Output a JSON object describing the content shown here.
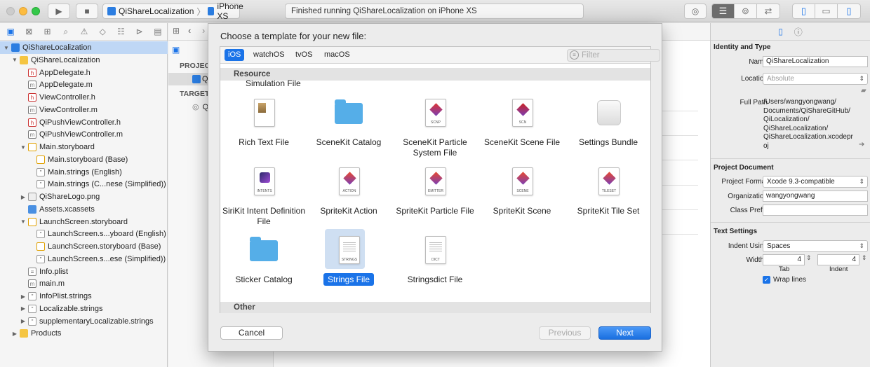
{
  "toolbar": {
    "scheme_project": "QiShareLocalization",
    "scheme_sep": "〉",
    "scheme_device": "iPhone XS",
    "status_text": "Finished running QiShareLocalization on iPhone XS"
  },
  "navigator": {
    "items": [
      {
        "label": "QiShareLocalization",
        "icon": "project",
        "indent": 0,
        "disclosure": "▼",
        "selected": true
      },
      {
        "label": "QiShareLocalization",
        "icon": "folder",
        "indent": 1,
        "disclosure": "▼"
      },
      {
        "label": "AppDelegate.h",
        "icon": "h",
        "indent": 2
      },
      {
        "label": "AppDelegate.m",
        "icon": "m",
        "indent": 2
      },
      {
        "label": "ViewController.h",
        "icon": "h",
        "indent": 2
      },
      {
        "label": "ViewController.m",
        "icon": "m",
        "indent": 2
      },
      {
        "label": "QiPushViewController.h",
        "icon": "h",
        "indent": 2
      },
      {
        "label": "QiPushViewController.m",
        "icon": "m",
        "indent": 2
      },
      {
        "label": "Main.storyboard",
        "icon": "sb",
        "indent": 2,
        "disclosure": "▼"
      },
      {
        "label": "Main.storyboard (Base)",
        "icon": "sb",
        "indent": 3
      },
      {
        "label": "Main.strings (English)",
        "icon": "str",
        "indent": 3
      },
      {
        "label": "Main.strings (C...nese (Simplified))",
        "icon": "str",
        "indent": 3
      },
      {
        "label": "QiShareLogo.png",
        "icon": "img",
        "indent": 2,
        "disclosure": "▶"
      },
      {
        "label": "Assets.xcassets",
        "icon": "assets",
        "indent": 2
      },
      {
        "label": "LaunchScreen.storyboard",
        "icon": "sb",
        "indent": 2,
        "disclosure": "▼"
      },
      {
        "label": "LaunchScreen.s...yboard (English)",
        "icon": "str",
        "indent": 3
      },
      {
        "label": "LaunchScreen.storyboard (Base)",
        "icon": "sb",
        "indent": 3
      },
      {
        "label": "LaunchScreen.s...ese (Simplified))",
        "icon": "str",
        "indent": 3
      },
      {
        "label": "Info.plist",
        "icon": "plist",
        "indent": 2
      },
      {
        "label": "main.m",
        "icon": "m",
        "indent": 2
      },
      {
        "label": "InfoPlist.strings",
        "icon": "str",
        "indent": 2,
        "disclosure": "▶"
      },
      {
        "label": "Localizable.strings",
        "icon": "str",
        "indent": 2,
        "disclosure": "▶"
      },
      {
        "label": "supplementaryLocalizable.strings",
        "icon": "str",
        "indent": 2,
        "disclosure": "▶"
      },
      {
        "label": "Products",
        "icon": "folder",
        "indent": 1,
        "disclosure": "▶"
      }
    ]
  },
  "editor": {
    "project_header": "PROJECT",
    "project_item": "Q",
    "targets_header": "TARGETS",
    "target_item": "Q"
  },
  "dialog": {
    "title": "Choose a template for your new file:",
    "platforms": [
      "iOS",
      "watchOS",
      "tvOS",
      "macOS"
    ],
    "filter_placeholder": "Filter",
    "section_resource": "Resource",
    "cut_item": "Simulation File",
    "templates": [
      {
        "label": "Rich Text File",
        "icon": "rtf"
      },
      {
        "label": "SceneKit Catalog",
        "icon": "folder"
      },
      {
        "label": "SceneKit Particle System File",
        "icon": "doc",
        "caption": "SCNP",
        "color": "#d33"
      },
      {
        "label": "SceneKit Scene File",
        "icon": "doc",
        "caption": "SCN",
        "color": "#c22"
      },
      {
        "label": "Settings Bundle",
        "icon": "bundle"
      },
      {
        "label": "SiriKit Intent Definition File",
        "icon": "intents",
        "caption": "INTENTS"
      },
      {
        "label": "SpriteKit Action",
        "icon": "doc",
        "caption": "ACTION",
        "color": "#e8492f"
      },
      {
        "label": "SpriteKit Particle File",
        "icon": "doc",
        "caption": "EMITTER",
        "color": "#e8492f"
      },
      {
        "label": "SpriteKit Scene",
        "icon": "doc",
        "caption": "SCENE",
        "color": "#e8492f"
      },
      {
        "label": "SpriteKit Tile Set",
        "icon": "doc",
        "caption": "TILESET",
        "color": "#e8492f"
      },
      {
        "label": "Sticker Catalog",
        "icon": "folder"
      },
      {
        "label": "Strings File",
        "icon": "strings",
        "caption": "STRINGS",
        "selected": true
      },
      {
        "label": "Stringsdict File",
        "icon": "dict",
        "caption": "DICT"
      }
    ],
    "section_other": "Other",
    "cancel_label": "Cancel",
    "previous_label": "Previous",
    "next_label": "Next"
  },
  "inspector": {
    "identity_title": "Identity and Type",
    "name_label": "Name",
    "name_value": "QiShareLocalization",
    "location_label": "Location",
    "location_value": "Absolute",
    "fullpath_label": "Full Path",
    "fullpath_lines": [
      "/Users/wangyongwang/",
      "Documents/QiShareGitHub/",
      "QiLocalization/",
      "QiShareLocalization/",
      "QiShareLocalization.xcodepr",
      "oj"
    ],
    "project_doc_title": "Project Document",
    "format_label": "Project Format",
    "format_value": "Xcode 9.3-compatible",
    "org_label": "Organization",
    "org_value": "wangyongwang",
    "prefix_label": "Class Prefix",
    "prefix_value": "",
    "text_settings_title": "Text Settings",
    "indent_label": "Indent Using",
    "indent_value": "Spaces",
    "widths_label": "Widths",
    "tab_value": "4",
    "indent_width_value": "4",
    "tab_caption": "Tab",
    "indent_caption": "Indent",
    "wrap_label": "Wrap lines",
    "wrap_checked": true
  },
  "colors": {
    "accent": "#1a73e8",
    "selection": "#bfd7f5"
  }
}
